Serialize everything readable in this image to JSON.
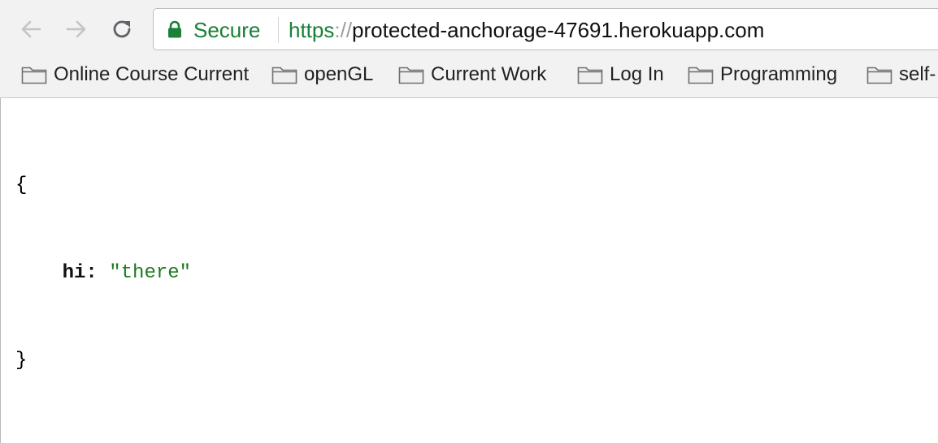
{
  "toolbar": {
    "back_icon": "back-arrow-icon",
    "forward_icon": "forward-arrow-icon",
    "reload_icon": "reload-icon"
  },
  "omnibox": {
    "lock_icon": "lock-icon",
    "secure_label": "Secure",
    "url_scheme": "https",
    "url_separator": "://",
    "url_host": "protected-anchorage-47691.herokuapp.com",
    "secure_color": "#188038"
  },
  "bookmarks": [
    {
      "label": "Online Course Current",
      "icon": "folder-icon"
    },
    {
      "label": "openGL",
      "icon": "folder-icon"
    },
    {
      "label": "Current Work",
      "icon": "folder-icon"
    },
    {
      "label": "Log In",
      "icon": "folder-icon"
    },
    {
      "label": "Programming",
      "icon": "folder-icon"
    },
    {
      "label": "self-",
      "icon": "folder-icon"
    }
  ],
  "json_view": {
    "open_brace": "{",
    "key": "hi",
    "colon": ":",
    "value": "\"there\"",
    "close_brace": "}",
    "string_color": "#1f7a1f"
  }
}
